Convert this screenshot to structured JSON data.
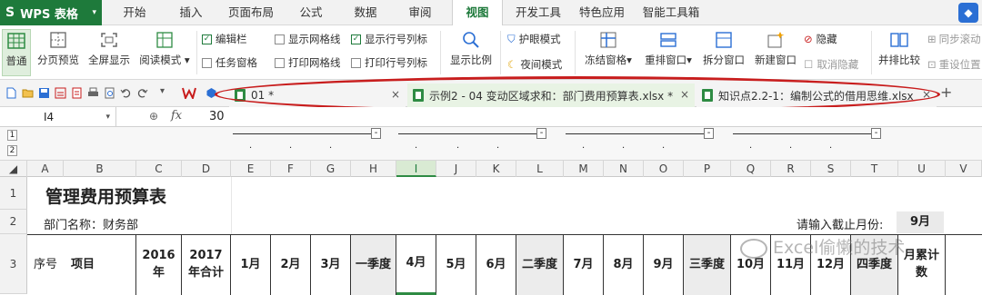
{
  "menubar": {
    "app_label": "WPS 表格",
    "tabs": [
      "开始",
      "插入",
      "页面布局",
      "公式",
      "数据",
      "审阅",
      "视图",
      "开发工具",
      "特色应用",
      "智能工具箱"
    ],
    "active_tab": "视图"
  },
  "ribbon": {
    "big_buttons": [
      "普通",
      "分页预览",
      "全屏显示",
      "阅读模式",
      "显示比例",
      "冻结窗格",
      "重排窗口",
      "拆分窗口",
      "新建窗口",
      "并排比较"
    ],
    "checks": [
      {
        "label": "编辑栏",
        "checked": true
      },
      {
        "label": "任务窗格",
        "checked": false
      },
      {
        "label": "显示网格线",
        "checked": false
      },
      {
        "label": "显示行号列标",
        "checked": true
      },
      {
        "label": "打印网格线",
        "checked": false
      },
      {
        "label": "打印行号列标",
        "checked": false
      }
    ],
    "protect_mode": "护眼模式",
    "night_mode": "夜间模式",
    "hide": "隐藏",
    "unhide": "取消隐藏",
    "sync_scroll": "同步滚动",
    "reset_pos": "重设位置"
  },
  "doc_tabs": [
    {
      "label": "01 *",
      "active": false
    },
    {
      "label": "示例2 - 04 变动区域求和：部门费用预算表.xlsx *",
      "active": true
    },
    {
      "label": "知识点2.2-1：编制公式的借用思维.xlsx",
      "active": false
    }
  ],
  "formula_bar": {
    "cell_ref": "I4",
    "fx": "fx",
    "value": "30"
  },
  "outline_levels": [
    "1",
    "2"
  ],
  "columns": [
    "A",
    "B",
    "C",
    "D",
    "E",
    "F",
    "G",
    "H",
    "I",
    "J",
    "K",
    "L",
    "M",
    "N",
    "O",
    "P",
    "Q",
    "R",
    "S",
    "T",
    "U",
    "V"
  ],
  "selected_column": "I",
  "rows": [
    "1",
    "2",
    "3"
  ],
  "sheet": {
    "title": "管理费用预算表",
    "dept": "部门名称：财务部",
    "prompt": "请输入截止月份:",
    "month": "9月",
    "headers": [
      "序号",
      "项目",
      "2016年",
      "2017年合计",
      "1月",
      "2月",
      "3月",
      "一季度",
      "4月",
      "5月",
      "6月",
      "二季度",
      "7月",
      "8月",
      "9月",
      "三季度",
      "10月",
      "11月",
      "12月",
      "四季度",
      "月累计数"
    ]
  },
  "watermark": "Excel偷懒的技术",
  "colors": {
    "brand_green": "#1e7a3b",
    "highlight_red": "#c81d1d"
  }
}
